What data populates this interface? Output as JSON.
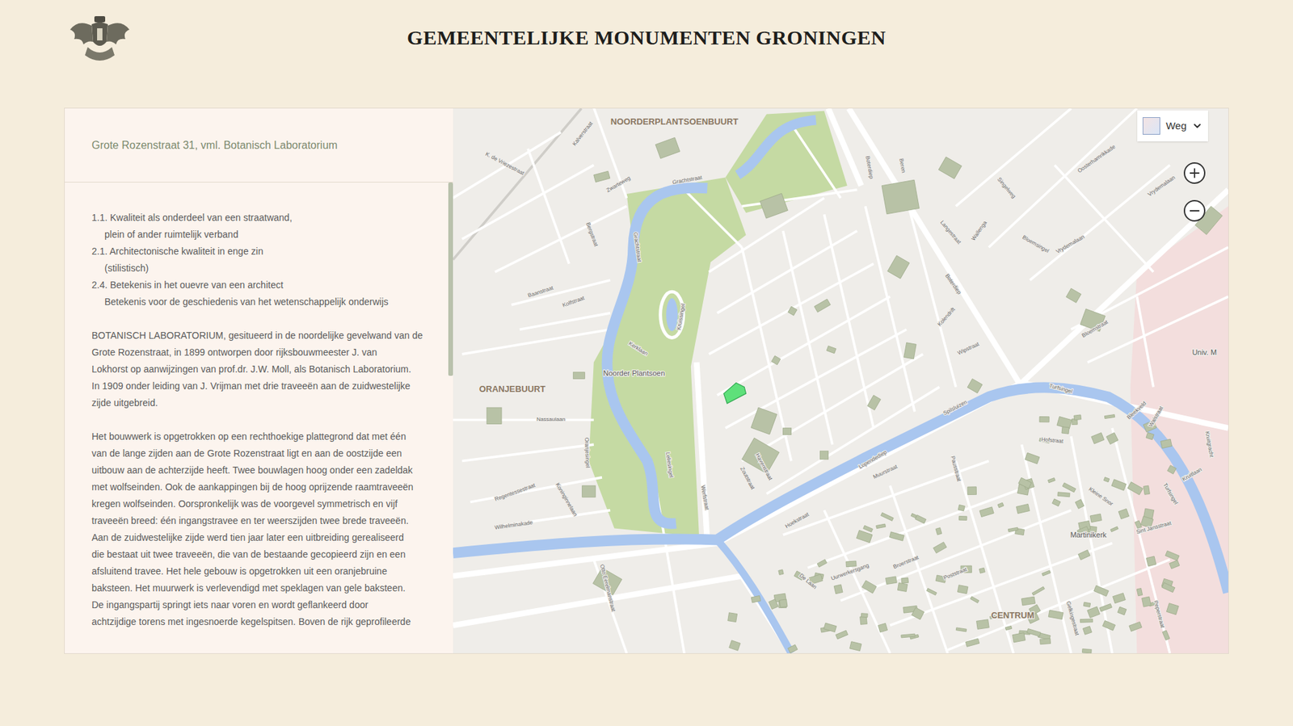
{
  "header": {
    "title": "GEMEENTELIJKE MONUMENTEN GRONINGEN"
  },
  "panel": {
    "title": "Grote Rozenstraat 31, vml. Botanisch Laboratorium",
    "criteria": [
      {
        "lines": [
          "1.1. Kwaliteit als onderdeel van een straatwand,",
          "plein of ander ruimtelijk verband"
        ]
      },
      {
        "lines": [
          "2.1. Architectonische kwaliteit in enge zin",
          "(stilistisch)"
        ]
      },
      {
        "lines": [
          "2.4. Betekenis in het ouevre van een architect",
          "Betekenis voor de geschiedenis van het wetenschappelijk onderwijs"
        ]
      }
    ],
    "paragraphs": [
      [
        "BOTANISCH LABORATORIUM, gesitueerd in de noordelijke gevelwand van de",
        "Grote Rozenstraat, in 1899 ontworpen door rijksbouwmeester J. van",
        "Lokhorst op aanwijzingen van prof.dr. J.W. Moll, als Botanisch Laboratorium.",
        "In 1909 onder leiding van J. Vrijman met drie traveeën aan de zuidwestelijke",
        "zijde uitgebreid."
      ],
      [
        "Het bouwwerk is opgetrokken op een rechthoekige plattegrond dat met één",
        "van de lange zijden aan de Grote Rozenstraat ligt en aan de oostzijde een",
        "uitbouw aan de achterzijde heeft. Twee bouwlagen hoog onder een zadeldak",
        "met wolfseinden. Ook de aankappingen bij de hoog oprijzende raamtraveeën",
        "kregen wolfseinden. Oorspronkelijk was de voorgevel symmetrisch en vijf",
        "traveeën breed: één ingangstravee en ter weerszijden twee brede traveeën.",
        "Aan de zuidwestelijke zijde werd tien jaar later een uitbreiding gerealiseerd",
        "die bestaat uit twee traveeën, die van de bestaande gecopieerd zijn en een",
        "afsluitend travee. Het hele gebouw is opgetrokken uit een oranjebruine",
        "baksteen. Het muurwerk is verlevendigd met speklagen van gele baksteen.",
        "De ingangspartij springt iets naar voren en wordt geflankeerd door",
        "achtzijdige torens met ingesnoerde kegelspitsen. Boven de rijk geprofileerde"
      ]
    ],
    "scroll": {
      "level": 0.41
    }
  },
  "map": {
    "layer": {
      "label": "Weg"
    },
    "labels": [
      {
        "text": "NOORDERPLANTSOENBUURT",
        "kind": "district"
      },
      {
        "text": "ORANJEBUURT",
        "kind": "district"
      },
      {
        "text": "CENTRUM",
        "kind": "district"
      },
      {
        "text": "Noorder Plantsoen",
        "kind": "place"
      },
      {
        "text": "Martinikerk",
        "kind": "place"
      },
      {
        "text": "Univ. M",
        "kind": "place"
      },
      {
        "text": "Kalverstraat",
        "kind": "street"
      },
      {
        "text": "K. de Vriezestraat",
        "kind": "street"
      },
      {
        "text": "Zwarteweg",
        "kind": "street"
      },
      {
        "text": "Grachtstraat",
        "kind": "street"
      },
      {
        "text": "Bergstraat",
        "kind": "street"
      },
      {
        "text": "Grachtstraat",
        "kind": "street"
      },
      {
        "text": "Baanstraat",
        "kind": "street"
      },
      {
        "text": "Kolfstraat",
        "kind": "street"
      },
      {
        "text": "Kerklaan",
        "kind": "street"
      },
      {
        "text": "Kruissingel",
        "kind": "street"
      },
      {
        "text": "Nassaulaan",
        "kind": "street"
      },
      {
        "text": "Oranjesingel",
        "kind": "street"
      },
      {
        "text": "Leliesingel",
        "kind": "street"
      },
      {
        "text": "Werfstraat",
        "kind": "street"
      },
      {
        "text": "Regentessestraat",
        "kind": "street"
      },
      {
        "text": "Koninginnelaan",
        "kind": "street"
      },
      {
        "text": "Wilhelminakade",
        "kind": "street"
      },
      {
        "text": "Otto Eerelmanstraat",
        "kind": "street"
      },
      {
        "text": "Havenstraat",
        "kind": "street"
      },
      {
        "text": "Zoutstraat",
        "kind": "street"
      },
      {
        "text": "Lopendediep",
        "kind": "street"
      },
      {
        "text": "Muurstraat",
        "kind": "street"
      },
      {
        "text": "Spilsluizen",
        "kind": "street"
      },
      {
        "text": "Turfsingel",
        "kind": "street"
      },
      {
        "text": "Hofstraat",
        "kind": "street"
      },
      {
        "text": "Pausstraat",
        "kind": "street"
      },
      {
        "text": "Boterdiep",
        "kind": "street"
      },
      {
        "text": "Boterdiep",
        "kind": "street"
      },
      {
        "text": "Beren",
        "kind": "street"
      },
      {
        "text": "Langestraat",
        "kind": "street"
      },
      {
        "text": "Wallenga",
        "kind": "street"
      },
      {
        "text": "Singelweg",
        "kind": "street"
      },
      {
        "text": "Bloemsingel",
        "kind": "street"
      },
      {
        "text": "Vrydemalaan",
        "kind": "street"
      },
      {
        "text": "Vrydemalaan",
        "kind": "street"
      },
      {
        "text": "Oosterhamrikkade",
        "kind": "street"
      },
      {
        "text": "Kolendrift",
        "kind": "street"
      },
      {
        "text": "Wipstraat",
        "kind": "street"
      },
      {
        "text": "Bloemstraat",
        "kind": "street"
      },
      {
        "text": "Bleekveld",
        "kind": "street"
      },
      {
        "text": "Walstraat",
        "kind": "street"
      },
      {
        "text": "Kleine Snor",
        "kind": "street"
      },
      {
        "text": "Sint Jansstraat",
        "kind": "street"
      },
      {
        "text": "Turfsingel",
        "kind": "street"
      },
      {
        "text": "Kruitlaan",
        "kind": "street"
      },
      {
        "text": "Kruitgracht",
        "kind": "street"
      },
      {
        "text": "Hoekstraat",
        "kind": "street"
      },
      {
        "text": "De Laan",
        "kind": "street"
      },
      {
        "text": "Uurwerkersgang",
        "kind": "street"
      },
      {
        "text": "Broerstraat",
        "kind": "street"
      },
      {
        "text": "Poststraat",
        "kind": "street"
      },
      {
        "text": "Gelkingestraat",
        "kind": "street"
      },
      {
        "text": "Peperstraat",
        "kind": "street"
      }
    ]
  }
}
